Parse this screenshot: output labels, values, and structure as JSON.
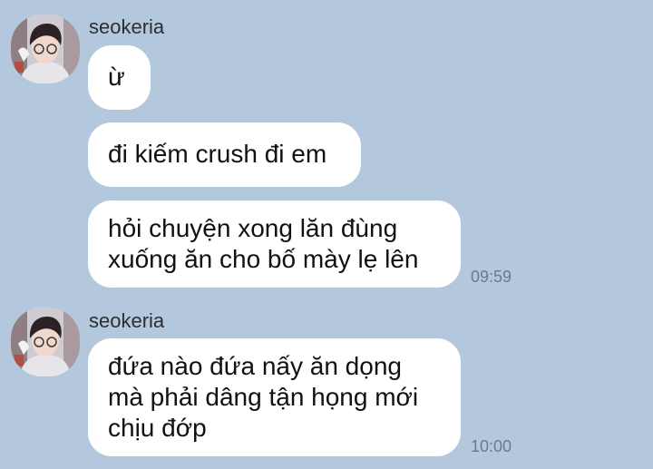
{
  "chat": {
    "groups": [
      {
        "sender": "seokeria",
        "avatar_icon": "profile-photo",
        "messages": [
          {
            "lines": [
              "ừ"
            ]
          },
          {
            "lines": [
              "đi kiếm crush đi em"
            ]
          },
          {
            "lines": [
              "hỏi chuyện xong lăn đùng",
              "xuống ăn cho bố mày lẹ lên"
            ]
          }
        ],
        "time": "09:59"
      },
      {
        "sender": "seokeria",
        "avatar_icon": "profile-photo",
        "messages": [
          {
            "lines": [
              "đứa nào đứa nấy ăn dọng",
              "mà phải dâng tận họng mới",
              "chịu đớp"
            ]
          }
        ],
        "time": "10:00"
      }
    ]
  },
  "colors": {
    "background": "#b3c7dd",
    "bubble": "#ffffff",
    "text": "#111111",
    "timestamp": "#707a85"
  }
}
